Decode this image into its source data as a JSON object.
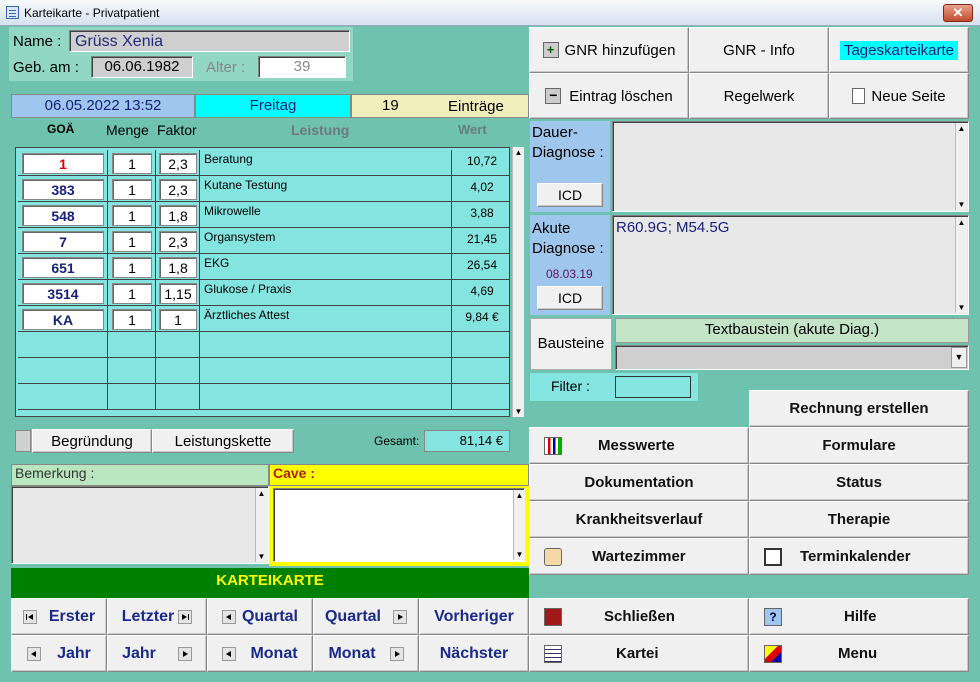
{
  "window": {
    "title": "Karteikarte - Privatpatient",
    "close": "✕"
  },
  "patient": {
    "name_label": "Name :",
    "name": "Grüss Xenia",
    "dob_label": "Geb. am :",
    "dob": "06.06.1982",
    "age_label": "Alter :",
    "age": "39"
  },
  "dayinfo": {
    "datetime": "06.05.2022 13:52",
    "weekday": "Freitag",
    "count": "19",
    "entries_label": "Einträge"
  },
  "table": {
    "headers": {
      "goa": "GOÄ",
      "menge": "Menge",
      "faktor": "Faktor",
      "leistung": "Leistung",
      "wert": "Wert"
    },
    "rows": [
      {
        "goa": "1",
        "menge": "1",
        "faktor": "2,3",
        "leistung": "Beratung",
        "wert": "10,72"
      },
      {
        "goa": "383",
        "menge": "1",
        "faktor": "2,3",
        "leistung": "Kutane Testung",
        "wert": "4,02"
      },
      {
        "goa": "548",
        "menge": "1",
        "faktor": "1,8",
        "leistung": "Mikrowelle",
        "wert": "3,88"
      },
      {
        "goa": "7",
        "menge": "1",
        "faktor": "2,3",
        "leistung": "Organsystem",
        "wert": "21,45"
      },
      {
        "goa": "651",
        "menge": "1",
        "faktor": "1,8",
        "leistung": "EKG",
        "wert": "26,54"
      },
      {
        "goa": "3514",
        "menge": "1",
        "faktor": "1,15",
        "leistung": "Glukose / Praxis",
        "wert": "4,69"
      },
      {
        "goa": "KA",
        "menge": "1",
        "faktor": "1",
        "leistung": "Ärztliches Attest",
        "wert": "9,84 €"
      }
    ],
    "total_label": "Gesamt:",
    "total": "81,14 €"
  },
  "below_table": {
    "begruendung": "Begründung",
    "leistungskette": "Leistungskette"
  },
  "notes": {
    "bemerkung_label": "Bemerkung :",
    "bemerkung": "",
    "cave_label": "Cave :",
    "cave": ""
  },
  "karteikarte": {
    "title": "KARTEIKARTE",
    "erster": "Erster",
    "letzter": "Letzter",
    "quartal": "Quartal",
    "vorheriger": "Vorheriger",
    "jahr": "Jahr",
    "monat": "Monat",
    "naechster": "Nächster"
  },
  "topbuttons": {
    "gnr_add": "GNR hinzufügen",
    "gnr_info": "GNR - Info",
    "tageskarteikarte": "Tageskarteikarte",
    "eintrag_loeschen": "Eintrag löschen",
    "regelwerk": "Regelwerk",
    "neue_seite": "Neue Seite"
  },
  "diagnose": {
    "dauer_label": "Dauer-\nDiagnose :",
    "icd": "ICD",
    "akut_label": "Akute\nDiagnose :",
    "akut_date": "08.03.19",
    "akut_value": "R60.9G; M54.5G",
    "dauer_value": ""
  },
  "bausteine": {
    "label": "Bausteine",
    "textbaustein": "Textbaustein (akute Diag.)",
    "select_value": "",
    "filter_label": "Filter :",
    "filter_value": ""
  },
  "menu": {
    "rechnung": "Rechnung erstellen",
    "messwerte": "Messwerte",
    "formulare": "Formulare",
    "dokumentation": "Dokumentation",
    "status": "Status",
    "krankheitsverlauf": "Krankheitsverlauf",
    "therapie": "Therapie",
    "wartezimmer": "Wartezimmer",
    "terminkalender": "Terminkalender",
    "schliessen": "Schließen",
    "hilfe": "Hilfe",
    "kartei": "Kartei",
    "menu": "Menu"
  },
  "colors": {
    "bg": "#6fc2ad",
    "grid": "#84e4e0",
    "accent_cyan": "#00ffff",
    "green_header": "#008000",
    "yellow": "#ffff00"
  }
}
